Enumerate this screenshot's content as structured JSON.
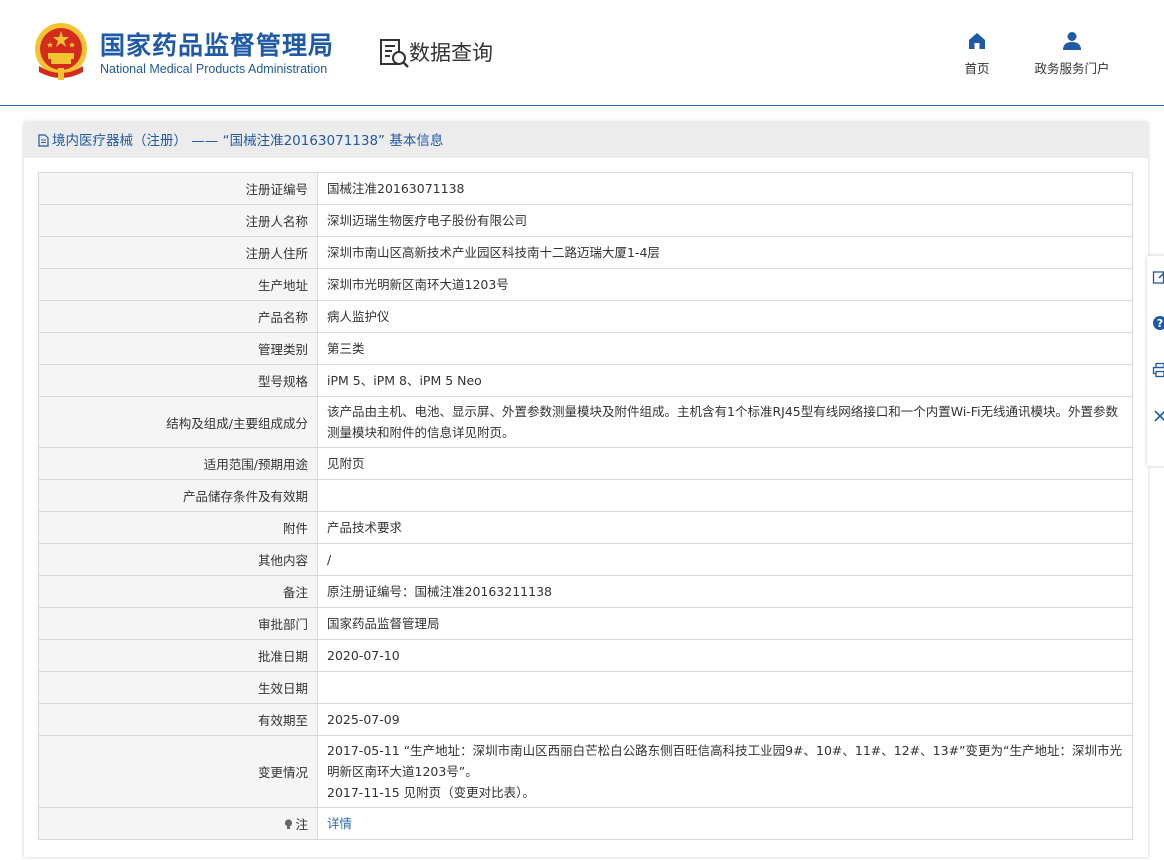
{
  "header": {
    "site_name_cn": "国家药品监督管理局",
    "site_name_en": "National Medical Products Administration",
    "section_title": "数据查询",
    "nav": [
      {
        "label": "首页",
        "icon": "home-icon"
      },
      {
        "label": "政务服务门户",
        "icon": "user-icon"
      }
    ]
  },
  "panel": {
    "title": "境内医疗器械（注册） —— “国械注准20163071138” 基本信息",
    "rows": [
      {
        "label": "注册证编号",
        "value": "国械注准20163071138"
      },
      {
        "label": "注册人名称",
        "value": "深圳迈瑞生物医疗电子股份有限公司"
      },
      {
        "label": "注册人住所",
        "value": "深圳市南山区高新技术产业园区科技南十二路迈瑞大厦1-4层"
      },
      {
        "label": "生产地址",
        "value": "深圳市光明新区南环大道1203号"
      },
      {
        "label": "产品名称",
        "value": "病人监护仪"
      },
      {
        "label": "管理类别",
        "value": "第三类"
      },
      {
        "label": "型号规格",
        "value": "iPM 5、iPM 8、iPM 5 Neo"
      },
      {
        "label": "结构及组成/主要组成成分",
        "value": "该产品由主机、电池、显示屏、外置参数测量模块及附件组成。主机含有1个标准RJ45型有线网络接口和一个内置Wi-Fi无线通讯模块。外置参数测量模块和附件的信息详见附页。"
      },
      {
        "label": "适用范围/预期用途",
        "value": "见附页"
      },
      {
        "label": "产品储存条件及有效期",
        "value": ""
      },
      {
        "label": "附件",
        "value": "产品技术要求"
      },
      {
        "label": "其他内容",
        "value": "/"
      },
      {
        "label": "备注",
        "value": "原注册证编号：国械注准20163211138"
      },
      {
        "label": "审批部门",
        "value": "国家药品监督管理局"
      },
      {
        "label": "批准日期",
        "value": "2020-07-10"
      },
      {
        "label": "生效日期",
        "value": ""
      },
      {
        "label": "有效期至",
        "value": "2025-07-09"
      },
      {
        "label": "变更情况",
        "value_lines": [
          "2017-05-11 “生产地址：深圳市南山区西丽白芒松白公路东侧百旺信高科技工业园9#、10#、11#、12#、13#”变更为“生产地址：深圳市光明新区南环大道1203号”。",
          "2017-11-15 见附页（变更对比表）。"
        ]
      },
      {
        "label": "注",
        "value": "详情",
        "is_link": true,
        "label_icon": "lightbulb-icon"
      }
    ]
  },
  "side_tools": [
    "edit-icon",
    "help-icon",
    "print-icon",
    "close-icon"
  ],
  "colors": {
    "brand_blue": "#1f5aa6",
    "link_blue": "#2e6bb0",
    "label_bg": "#f5f5f5",
    "border": "#d9d9d9",
    "emblem_red": "#d52b1e",
    "emblem_gold": "#f4c430"
  }
}
